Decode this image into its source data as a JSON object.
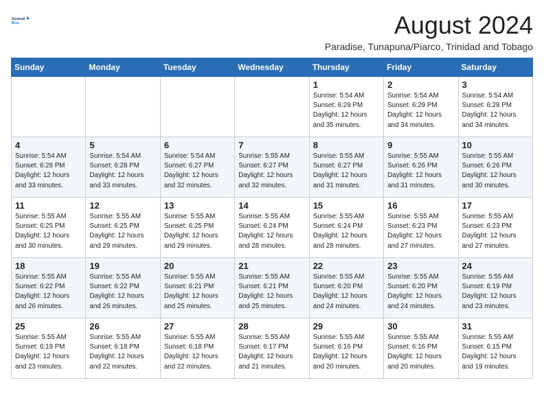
{
  "header": {
    "logo_line1": "General",
    "logo_line2": "Blue",
    "month_title": "August 2024",
    "subtitle": "Paradise, Tunapuna/Piarco, Trinidad and Tobago"
  },
  "days_of_week": [
    "Sunday",
    "Monday",
    "Tuesday",
    "Wednesday",
    "Thursday",
    "Friday",
    "Saturday"
  ],
  "weeks": [
    [
      {
        "day": "",
        "info": ""
      },
      {
        "day": "",
        "info": ""
      },
      {
        "day": "",
        "info": ""
      },
      {
        "day": "",
        "info": ""
      },
      {
        "day": "1",
        "info": "Sunrise: 5:54 AM\nSunset: 6:29 PM\nDaylight: 12 hours\nand 35 minutes."
      },
      {
        "day": "2",
        "info": "Sunrise: 5:54 AM\nSunset: 6:29 PM\nDaylight: 12 hours\nand 34 minutes."
      },
      {
        "day": "3",
        "info": "Sunrise: 5:54 AM\nSunset: 6:28 PM\nDaylight: 12 hours\nand 34 minutes."
      }
    ],
    [
      {
        "day": "4",
        "info": "Sunrise: 5:54 AM\nSunset: 6:28 PM\nDaylight: 12 hours\nand 33 minutes."
      },
      {
        "day": "5",
        "info": "Sunrise: 5:54 AM\nSunset: 6:28 PM\nDaylight: 12 hours\nand 33 minutes."
      },
      {
        "day": "6",
        "info": "Sunrise: 5:54 AM\nSunset: 6:27 PM\nDaylight: 12 hours\nand 32 minutes."
      },
      {
        "day": "7",
        "info": "Sunrise: 5:55 AM\nSunset: 6:27 PM\nDaylight: 12 hours\nand 32 minutes."
      },
      {
        "day": "8",
        "info": "Sunrise: 5:55 AM\nSunset: 6:27 PM\nDaylight: 12 hours\nand 31 minutes."
      },
      {
        "day": "9",
        "info": "Sunrise: 5:55 AM\nSunset: 6:26 PM\nDaylight: 12 hours\nand 31 minutes."
      },
      {
        "day": "10",
        "info": "Sunrise: 5:55 AM\nSunset: 6:26 PM\nDaylight: 12 hours\nand 30 minutes."
      }
    ],
    [
      {
        "day": "11",
        "info": "Sunrise: 5:55 AM\nSunset: 6:25 PM\nDaylight: 12 hours\nand 30 minutes."
      },
      {
        "day": "12",
        "info": "Sunrise: 5:55 AM\nSunset: 6:25 PM\nDaylight: 12 hours\nand 29 minutes."
      },
      {
        "day": "13",
        "info": "Sunrise: 5:55 AM\nSunset: 6:25 PM\nDaylight: 12 hours\nand 29 minutes."
      },
      {
        "day": "14",
        "info": "Sunrise: 5:55 AM\nSunset: 6:24 PM\nDaylight: 12 hours\nand 28 minutes."
      },
      {
        "day": "15",
        "info": "Sunrise: 5:55 AM\nSunset: 6:24 PM\nDaylight: 12 hours\nand 28 minutes."
      },
      {
        "day": "16",
        "info": "Sunrise: 5:55 AM\nSunset: 6:23 PM\nDaylight: 12 hours\nand 27 minutes."
      },
      {
        "day": "17",
        "info": "Sunrise: 5:55 AM\nSunset: 6:23 PM\nDaylight: 12 hours\nand 27 minutes."
      }
    ],
    [
      {
        "day": "18",
        "info": "Sunrise: 5:55 AM\nSunset: 6:22 PM\nDaylight: 12 hours\nand 26 minutes."
      },
      {
        "day": "19",
        "info": "Sunrise: 5:55 AM\nSunset: 6:22 PM\nDaylight: 12 hours\nand 26 minutes."
      },
      {
        "day": "20",
        "info": "Sunrise: 5:55 AM\nSunset: 6:21 PM\nDaylight: 12 hours\nand 25 minutes."
      },
      {
        "day": "21",
        "info": "Sunrise: 5:55 AM\nSunset: 6:21 PM\nDaylight: 12 hours\nand 25 minutes."
      },
      {
        "day": "22",
        "info": "Sunrise: 5:55 AM\nSunset: 6:20 PM\nDaylight: 12 hours\nand 24 minutes."
      },
      {
        "day": "23",
        "info": "Sunrise: 5:55 AM\nSunset: 6:20 PM\nDaylight: 12 hours\nand 24 minutes."
      },
      {
        "day": "24",
        "info": "Sunrise: 5:55 AM\nSunset: 6:19 PM\nDaylight: 12 hours\nand 23 minutes."
      }
    ],
    [
      {
        "day": "25",
        "info": "Sunrise: 5:55 AM\nSunset: 6:19 PM\nDaylight: 12 hours\nand 23 minutes."
      },
      {
        "day": "26",
        "info": "Sunrise: 5:55 AM\nSunset: 6:18 PM\nDaylight: 12 hours\nand 22 minutes."
      },
      {
        "day": "27",
        "info": "Sunrise: 5:55 AM\nSunset: 6:18 PM\nDaylight: 12 hours\nand 22 minutes."
      },
      {
        "day": "28",
        "info": "Sunrise: 5:55 AM\nSunset: 6:17 PM\nDaylight: 12 hours\nand 21 minutes."
      },
      {
        "day": "29",
        "info": "Sunrise: 5:55 AM\nSunset: 6:16 PM\nDaylight: 12 hours\nand 20 minutes."
      },
      {
        "day": "30",
        "info": "Sunrise: 5:55 AM\nSunset: 6:16 PM\nDaylight: 12 hours\nand 20 minutes."
      },
      {
        "day": "31",
        "info": "Sunrise: 5:55 AM\nSunset: 6:15 PM\nDaylight: 12 hours\nand 19 minutes."
      }
    ]
  ]
}
